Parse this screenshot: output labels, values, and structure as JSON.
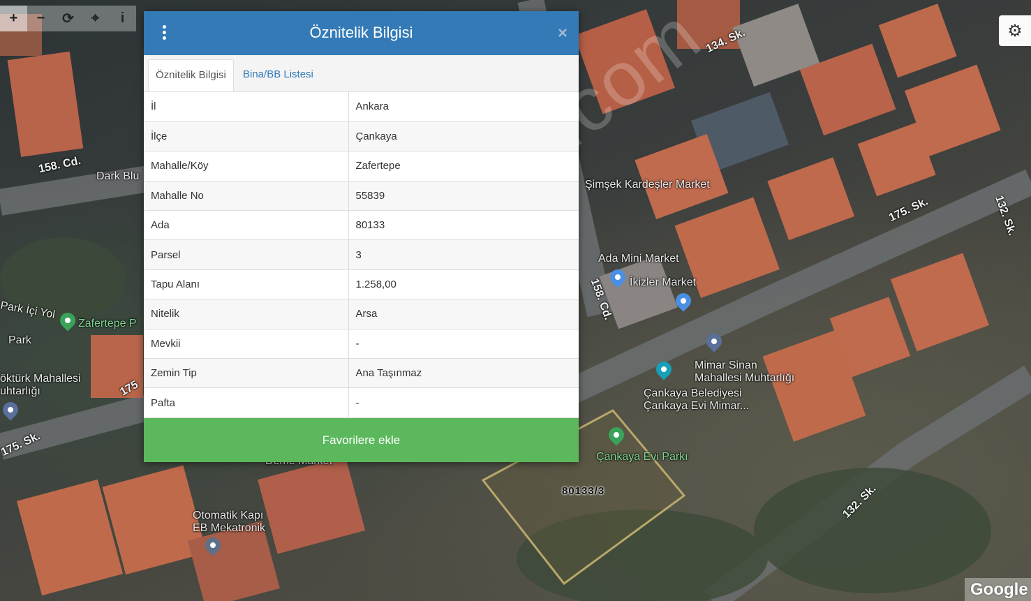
{
  "toolbar": {
    "buttons": [
      {
        "name": "zoom-in",
        "glyph": "+"
      },
      {
        "name": "zoom-out",
        "glyph": "−"
      },
      {
        "name": "refresh",
        "glyph": "⟳"
      },
      {
        "name": "locate",
        "glyph": "⌖"
      },
      {
        "name": "info",
        "glyph": "i"
      }
    ],
    "settings_glyph": "⚙"
  },
  "modal": {
    "title": "Öznitelik Bilgisi",
    "close_glyph": "×",
    "tabs": [
      {
        "label": "Öznitelik Bilgisi",
        "active": true
      },
      {
        "label": "Bina/BB Listesi",
        "active": false
      }
    ],
    "rows": [
      {
        "key": "İl",
        "value": "Ankara"
      },
      {
        "key": "İlçe",
        "value": "Çankaya"
      },
      {
        "key": "Mahalle/Köy",
        "value": "Zafertepe"
      },
      {
        "key": "Mahalle No",
        "value": "55839"
      },
      {
        "key": "Ada",
        "value": "80133"
      },
      {
        "key": "Parsel",
        "value": "3"
      },
      {
        "key": "Tapu Alanı",
        "value": "1.258,00"
      },
      {
        "key": "Nitelik",
        "value": "Arsa"
      },
      {
        "key": "Mevkii",
        "value": "-"
      },
      {
        "key": "Zemin Tip",
        "value": "Ana Taşınmaz"
      },
      {
        "key": "Pafta",
        "value": "-"
      }
    ],
    "favorite_button": "Favorilere ekle"
  },
  "map": {
    "parcel_label": "80133/3",
    "watermark": "emlakjet.com",
    "attribution": "Google",
    "labels": {
      "street_158_cd_a": "158. Cd.",
      "dark_blu": "Dark Blu",
      "street_134_sk": "134. Sk.",
      "simsek_market": "Şimşek Kardeşler Market",
      "street_175_sk_a": "175. Sk.",
      "street_132_sk_a": "132. Sk.",
      "ada_mini_market": "Ada Mini Market",
      "ikizler_market": "İkizler Market",
      "street_158_cd_b": "158. Cd.",
      "park_ici_yol": "Park İçi Yol",
      "zafertepe_park": "Zafertepe P",
      "park": "Park",
      "mimar_sinan_1": "Mimar Sinan",
      "mimar_sinan_2": "Mahallesi Muhtarlığı",
      "cankaya_bel_1": "Çankaya Belediyesi",
      "cankaya_bel_2": "Çankaya Evi Mimar...",
      "okturk_1": "öktürk Mahallesi",
      "okturk_2": "uhtarlığı",
      "street_175_left": "175",
      "street_175_sk_b": "175. Sk.",
      "cankaya_evi_parki": "Çankaya Evi Parkı",
      "deme_market": "Deme Market",
      "street_132_sk_b": "132. Sk.",
      "otomatik_1": "Otomatik Kapı",
      "otomatik_2": "EB Mekatronik"
    }
  }
}
